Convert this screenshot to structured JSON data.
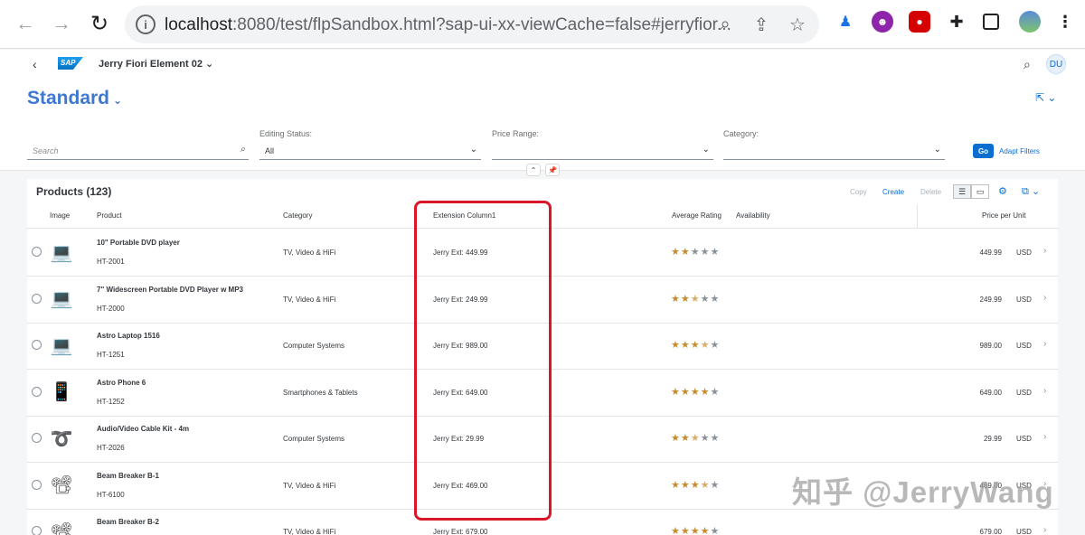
{
  "browser": {
    "url_host": "localhost",
    "url_rest": ":8080/test/flpSandbox.html?sap-ui-xx-viewCache=false#jerryfior..."
  },
  "shell": {
    "logo_text": "SAP",
    "app_title": "Jerry Fiori Element 02 ⌄",
    "avatar_initials": "DU"
  },
  "header": {
    "variant_name": "Standard"
  },
  "filters": {
    "search_placeholder": "Search",
    "editing_status_label": "Editing Status:",
    "editing_status_value": "All",
    "price_range_label": "Price Range:",
    "category_label": "Category:",
    "go_label": "Go",
    "adapt_label": "Adapt Filters"
  },
  "table": {
    "title": "Products (123)",
    "actions": {
      "copy": "Copy",
      "create": "Create",
      "delete": "Delete"
    },
    "columns": {
      "image": "Image",
      "product": "Product",
      "category": "Category",
      "extension": "Extension Column1",
      "rating": "Average Rating",
      "availability": "Availability",
      "price": "Price per Unit"
    },
    "rows": [
      {
        "name": "10\" Portable DVD player",
        "id": "HT-2001",
        "category": "TV, Video & HiFi",
        "ext": "Jerry Ext: 449.99",
        "rating": 2,
        "price": "449.99",
        "currency": "USD"
      },
      {
        "name": "7\" Widescreen Portable DVD Player w MP3",
        "id": "HT-2000",
        "category": "TV, Video & HiFi",
        "ext": "Jerry Ext: 249.99",
        "rating": 2.5,
        "price": "249.99",
        "currency": "USD"
      },
      {
        "name": "Astro Laptop 1516",
        "id": "HT-1251",
        "category": "Computer Systems",
        "ext": "Jerry Ext: 989.00",
        "rating": 3.5,
        "price": "989.00",
        "currency": "USD"
      },
      {
        "name": "Astro Phone 6",
        "id": "HT-1252",
        "category": "Smartphones & Tablets",
        "ext": "Jerry Ext: 649.00",
        "rating": 4,
        "price": "649.00",
        "currency": "USD"
      },
      {
        "name": "Audio/Video Cable Kit - 4m",
        "id": "HT-2026",
        "category": "Computer Systems",
        "ext": "Jerry Ext: 29.99",
        "rating": 2.5,
        "price": "29.99",
        "currency": "USD"
      },
      {
        "name": "Beam Breaker B-1",
        "id": "HT-6100",
        "category": "TV, Video & HiFi",
        "ext": "Jerry Ext: 469.00",
        "rating": 3.5,
        "price": "469.00",
        "currency": "USD"
      },
      {
        "name": "Beam Breaker B-2",
        "id": "",
        "category": "TV, Video & HiFi",
        "ext": "Jerry Ext: 679.00",
        "rating": 4,
        "price": "679.00",
        "currency": "USD"
      }
    ]
  },
  "watermark": "知乎 @JerryWang",
  "colors": {
    "accent": "#0a6ed1",
    "highlight": "#d9172a",
    "star": "#c68b2c"
  }
}
